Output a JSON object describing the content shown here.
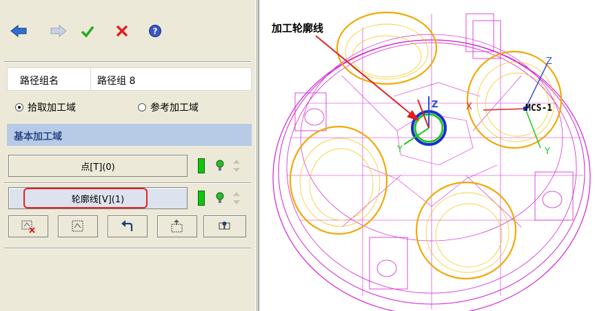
{
  "toolbar": {
    "icons": [
      "back-arrow-icon",
      "forward-arrow-icon",
      "check-icon",
      "close-icon",
      "help-icon"
    ],
    "colors": {
      "back": "#2f6fd0",
      "forward": "#b8c4d8",
      "check": "#22aa22",
      "close": "#e02020",
      "help": "#3a55c8"
    }
  },
  "path_group": {
    "label": "路径组名",
    "value": "路径组 8"
  },
  "domain_options": [
    {
      "label": "拾取加工域",
      "selected": true
    },
    {
      "label": "参考加工域",
      "selected": false
    }
  ],
  "section": {
    "title": "基本加工域"
  },
  "point_button": {
    "label": "点[T](0)"
  },
  "contour_button": {
    "label": "轮廓线[V](1)"
  },
  "bottom_icons": [
    "remove-item-icon",
    "select-item-icon",
    "undo-icon",
    "edit-item-icon",
    "settings-icon"
  ],
  "viewport": {
    "annotation": "加工轮廓线",
    "coord_system": "MCS-1",
    "axis_labels": {
      "z": "Z",
      "y": "Y",
      "x": "X"
    }
  }
}
